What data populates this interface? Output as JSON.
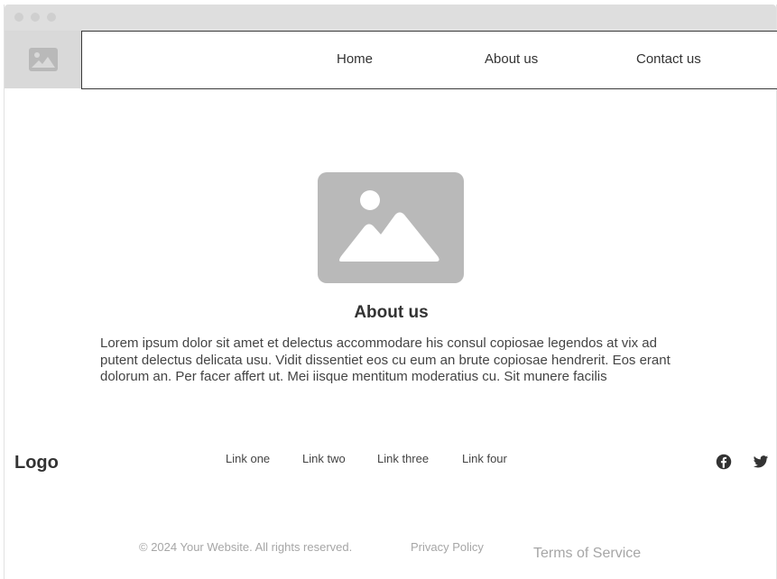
{
  "nav": {
    "items": [
      {
        "label": "Home"
      },
      {
        "label": "About us"
      },
      {
        "label": "Contact us"
      }
    ]
  },
  "main": {
    "heading": "About us",
    "paragraph": "Lorem ipsum dolor sit amet et delectus accommodare his consul copiosae legendos at vix ad putent delectus delicata usu. Vidit dissentiet eos cu eum an brute copiosae hendrerit. Eos erant dolorum an. Per facer affert ut. Mei iisque mentitum moderatius cu. Sit munere facilis"
  },
  "footer": {
    "logo": "Logo",
    "links": [
      {
        "label": "Link one"
      },
      {
        "label": "Link two"
      },
      {
        "label": "Link three"
      },
      {
        "label": "Link four"
      }
    ],
    "social_icons": [
      "facebook-icon",
      "twitter-icon"
    ],
    "copyright": "© 2024 Your Website. All rights reserved.",
    "privacy": "Privacy Policy",
    "terms": "Terms of Service"
  },
  "colors": {
    "titlebar": "#dedede",
    "placeholder": "#b9b9b9",
    "text": "#333333",
    "muted": "#a6a6a6"
  }
}
